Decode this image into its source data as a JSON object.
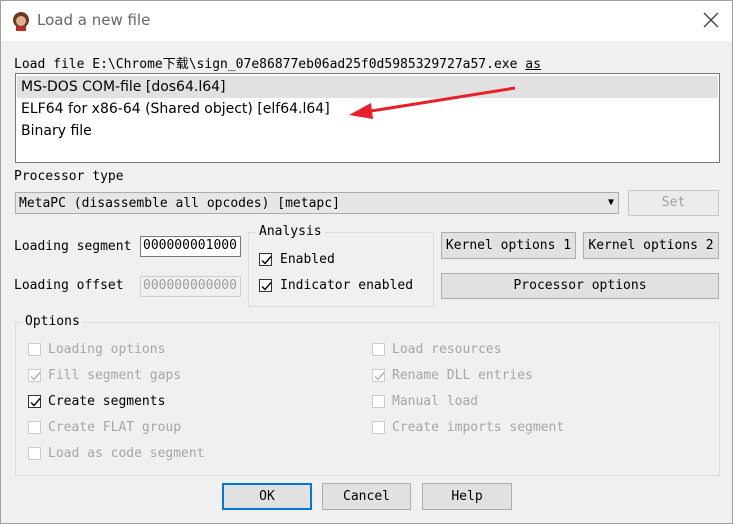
{
  "window": {
    "title": "Load a new file"
  },
  "load_file": {
    "label_prefix": "Load file",
    "path": "E:\\Chrome下载\\sign_07e86877eb06ad25f0d5985329727a57.exe",
    "label_suffix": "as"
  },
  "formats": [
    {
      "label": "MS-DOS COM-file [dos64.l64]",
      "selected": true
    },
    {
      "label": "ELF64 for x86-64 (Shared object) [elf64.l64]",
      "selected": false
    },
    {
      "label": "Binary file",
      "selected": false
    }
  ],
  "annotation": {
    "arrow_color": "#e8202a"
  },
  "processor": {
    "label": "Processor type",
    "selected": "MetaPC (disassemble all opcodes) [metapc]",
    "set_button": "Set"
  },
  "loading_segment": {
    "label": "Loading segment",
    "value": "000000001000"
  },
  "loading_offset": {
    "label": "Loading offset",
    "value": "000000000000"
  },
  "analysis": {
    "title": "Analysis",
    "enabled": {
      "label": "Enabled",
      "checked": true
    },
    "indicator": {
      "label": "Indicator enabled",
      "checked": true
    }
  },
  "buttons": {
    "kernel1": "Kernel options 1",
    "kernel2": "Kernel options 2",
    "processor_options": "Processor options",
    "ok": "OK",
    "cancel": "Cancel",
    "help": "Help"
  },
  "options": {
    "title": "Options",
    "left": [
      {
        "label": "Loading options",
        "checked": false,
        "enabled": false
      },
      {
        "label": "Fill segment gaps",
        "checked": true,
        "enabled": false
      },
      {
        "label": "Create segments",
        "checked": true,
        "enabled": true
      },
      {
        "label": "Create FLAT group",
        "checked": false,
        "enabled": false
      },
      {
        "label": "Load as code segment",
        "checked": false,
        "enabled": false
      }
    ],
    "right": [
      {
        "label": "Load resources",
        "checked": false,
        "enabled": false
      },
      {
        "label": "Rename DLL entries",
        "checked": true,
        "enabled": false
      },
      {
        "label": "Manual load",
        "checked": false,
        "enabled": false
      },
      {
        "label": "Create imports segment",
        "checked": false,
        "enabled": false
      }
    ]
  }
}
